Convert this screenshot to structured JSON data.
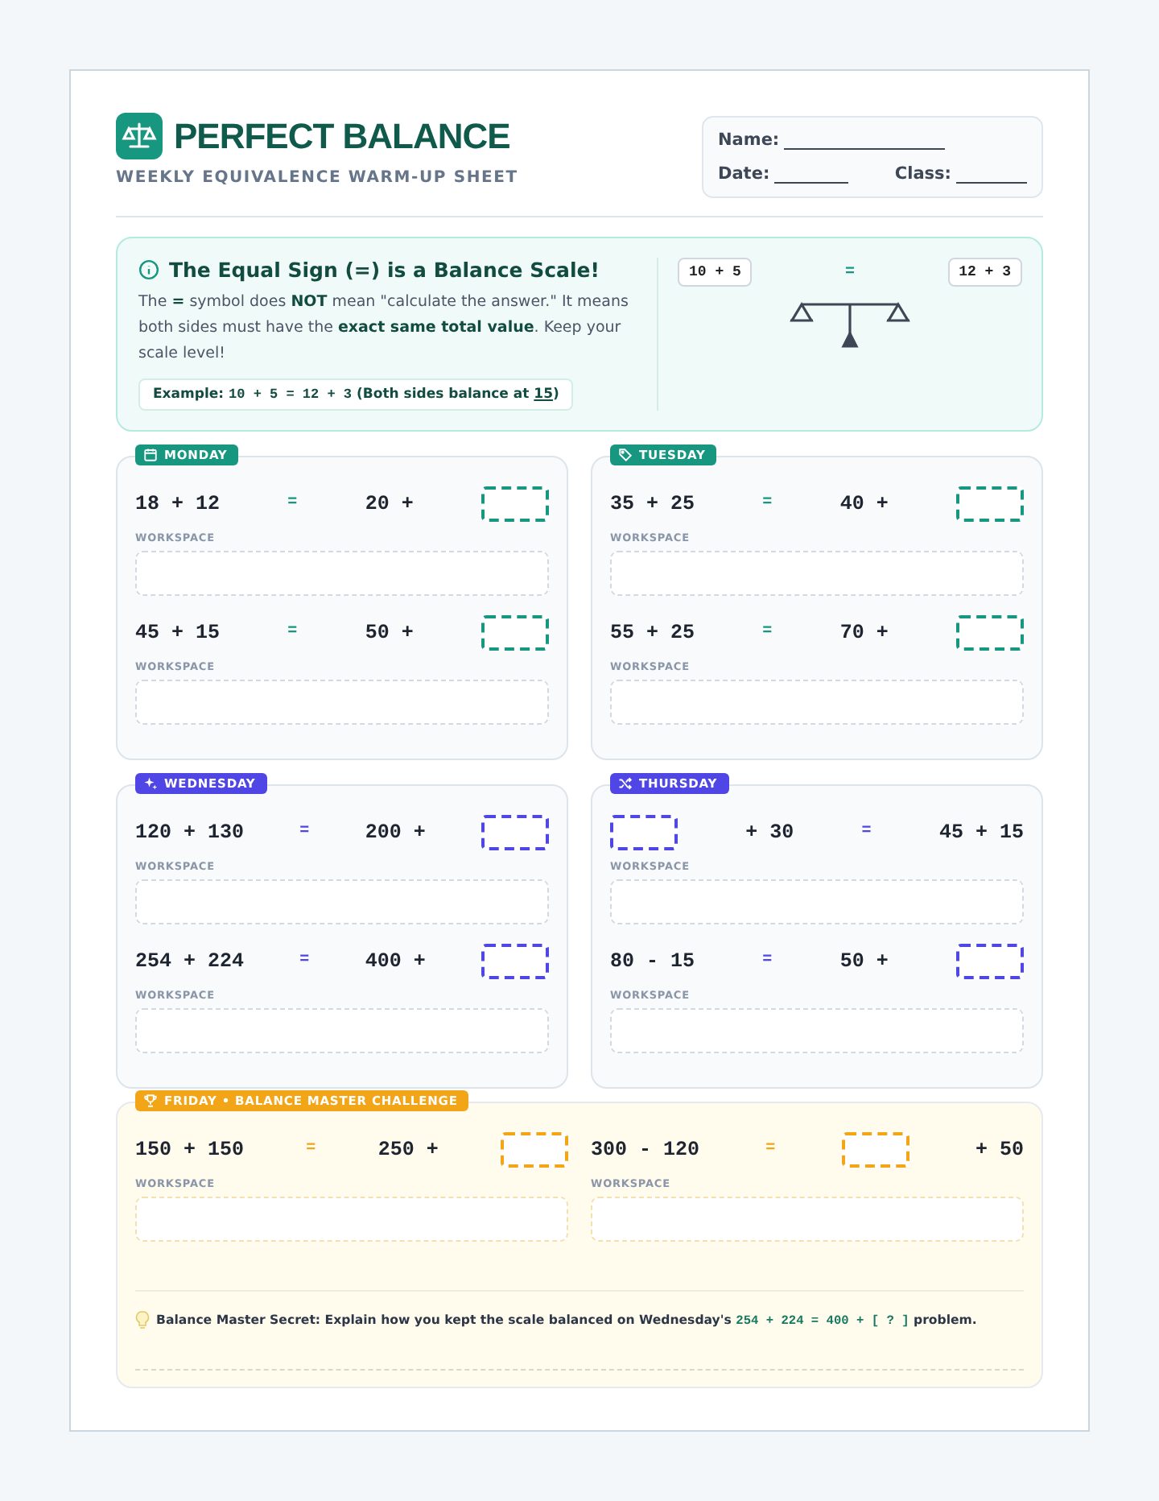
{
  "header": {
    "title": "PERFECT BALANCE",
    "subtitle": "WEEKLY EQUIVALENCE WARM-UP SHEET"
  },
  "student_fields": [
    {
      "label": "Name:"
    },
    {
      "label": "Date:"
    },
    {
      "label": "Class:"
    }
  ],
  "intro": {
    "title": "The Equal Sign (=) is a Balance Scale!",
    "body": "The **=** symbol does **NOT** mean \"calculate the answer.\" It means both sides must have the **exact same total value**. Keep your scale level!",
    "example": {
      "label": "Example:",
      "code": "10 + 5 = 12 + 3",
      "note": "(Both sides balance at ",
      "highlight": "15",
      "note_end": ")"
    },
    "scale": {
      "left": "10 + 5",
      "equals": "=",
      "right": "12 + 3"
    }
  },
  "days": [
    {
      "label": "MONDAY",
      "color": "#17977f",
      "problems": [
        {
          "parts": [
            {
              "kind": "text",
              "text": "18 + 12"
            },
            {
              "kind": "equals",
              "text": "="
            },
            {
              "kind": "text",
              "text": "20 +"
            },
            {
              "kind": "blank"
            }
          ],
          "workspace": "WORKSPACE"
        },
        {
          "parts": [
            {
              "kind": "text",
              "text": "45 + 15"
            },
            {
              "kind": "equals",
              "text": "="
            },
            {
              "kind": "text",
              "text": "50 +"
            },
            {
              "kind": "blank"
            }
          ],
          "workspace": "WORKSPACE"
        }
      ]
    },
    {
      "label": "TUESDAY",
      "color": "#17977f",
      "problems": [
        {
          "parts": [
            {
              "kind": "text",
              "text": "35 + 25"
            },
            {
              "kind": "equals",
              "text": "="
            },
            {
              "kind": "text",
              "text": "40 +"
            },
            {
              "kind": "blank"
            }
          ],
          "workspace": "WORKSPACE"
        },
        {
          "parts": [
            {
              "kind": "text",
              "text": "55 + 25"
            },
            {
              "kind": "equals",
              "text": "="
            },
            {
              "kind": "text",
              "text": "70 +"
            },
            {
              "kind": "blank"
            }
          ],
          "workspace": "WORKSPACE"
        }
      ]
    },
    {
      "label": "WEDNESDAY",
      "color": "#4f46e5",
      "problems": [
        {
          "parts": [
            {
              "kind": "text",
              "text": "120 + 130"
            },
            {
              "kind": "equals",
              "text": "="
            },
            {
              "kind": "text",
              "text": "200 +"
            },
            {
              "kind": "blank"
            }
          ],
          "workspace": "WORKSPACE"
        },
        {
          "parts": [
            {
              "kind": "text",
              "text": "254 + 224"
            },
            {
              "kind": "equals",
              "text": "="
            },
            {
              "kind": "text",
              "text": "400 +"
            },
            {
              "kind": "blank"
            }
          ],
          "workspace": "WORKSPACE"
        }
      ]
    },
    {
      "label": "THURSDAY",
      "color": "#4f46e5",
      "problems": [
        {
          "parts": [
            {
              "kind": "blank"
            },
            {
              "kind": "text",
              "text": "+ 30"
            },
            {
              "kind": "equals",
              "text": "="
            },
            {
              "kind": "text",
              "text": "45 + 15"
            }
          ],
          "workspace": "WORKSPACE"
        },
        {
          "parts": [
            {
              "kind": "text",
              "text": "80 - 15"
            },
            {
              "kind": "equals",
              "text": "="
            },
            {
              "kind": "text",
              "text": "50 +"
            },
            {
              "kind": "blank"
            }
          ],
          "workspace": "WORKSPACE"
        }
      ]
    }
  ],
  "friday": {
    "label": "FRIDAY • BALANCE MASTER CHALLENGE",
    "color": "#f2a516",
    "problems": [
      {
        "parts": [
          {
            "kind": "text",
            "text": "150 + 150"
          },
          {
            "kind": "equals",
            "text": "="
          },
          {
            "kind": "text",
            "text": "250 +"
          },
          {
            "kind": "blank"
          }
        ],
        "workspace": "WORKSPACE"
      },
      {
        "parts": [
          {
            "kind": "text",
            "text": "300 - 120"
          },
          {
            "kind": "equals",
            "text": "="
          },
          {
            "kind": "blank"
          },
          {
            "kind": "text",
            "text": "+ 50"
          }
        ],
        "workspace": "WORKSPACE"
      }
    ],
    "secret": {
      "lead": "Balance Master Secret: Explain how you kept the scale balanced on Wednesday's",
      "code": "254 + 224 = 400 + [ ? ]",
      "tail": "problem."
    }
  }
}
